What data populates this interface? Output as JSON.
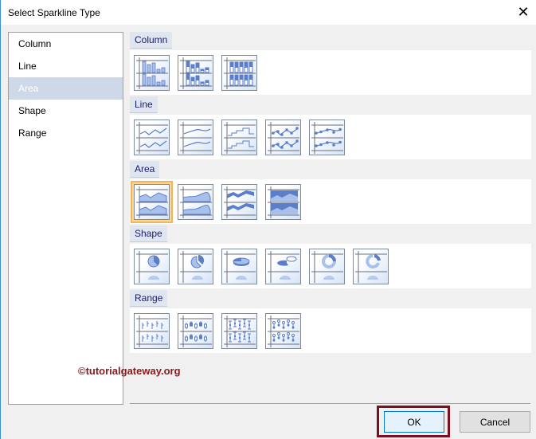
{
  "window": {
    "title": "Select Sparkline Type",
    "close_icon": "close-icon"
  },
  "categories": [
    {
      "label": "Column"
    },
    {
      "label": "Line"
    },
    {
      "label": "Area",
      "selected": true
    },
    {
      "label": "Shape"
    },
    {
      "label": "Range"
    }
  ],
  "sections": [
    {
      "label": "Column",
      "icons": [
        "column-basic",
        "column-stacked",
        "column-full"
      ]
    },
    {
      "label": "Line",
      "icons": [
        "line-basic",
        "line-smooth",
        "line-step",
        "line-markers",
        "line-smooth-markers"
      ]
    },
    {
      "label": "Area",
      "icons": [
        "area-basic",
        "area-smooth",
        "area-band",
        "area-full"
      ],
      "selected_index": 0
    },
    {
      "label": "Shape",
      "icons": [
        "pie",
        "pie-exploded",
        "pie-3d",
        "pie-3d-exploded",
        "doughnut",
        "doughnut-exploded"
      ]
    },
    {
      "label": "Range",
      "icons": [
        "range-bar",
        "range-candle",
        "range-errorbar",
        "range-stock"
      ]
    }
  ],
  "buttons": {
    "ok": "OK",
    "cancel": "Cancel"
  },
  "watermark": "©tutorialgateway.org",
  "colors": {
    "accent": "#5b7ec9",
    "selection_outline": "#f2b55a",
    "highlight_box": "#7d1020"
  }
}
